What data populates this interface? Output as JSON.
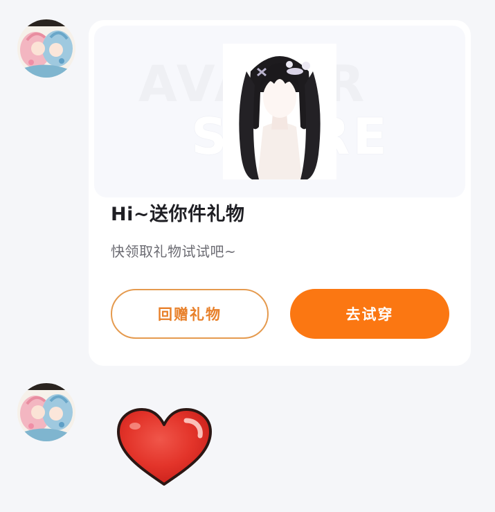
{
  "messages": [
    {
      "type": "gift_card",
      "banner": {
        "watermark_line1": "AVATAR",
        "watermark_line2": "STORE"
      },
      "title": "Hi~送你件礼物",
      "subtitle": "快领取礼物试试吧~",
      "buttons": {
        "return_gift": "回赠礼物",
        "try_on": "去试穿"
      }
    },
    {
      "type": "sticker",
      "icon": "red-heart"
    }
  ],
  "colors": {
    "page_background": "#f5f6f9",
    "card_background": "#ffffff",
    "accent_orange": "#fb7712",
    "outline_orange": "#e59a4e",
    "heart_red": "#e8352a"
  }
}
